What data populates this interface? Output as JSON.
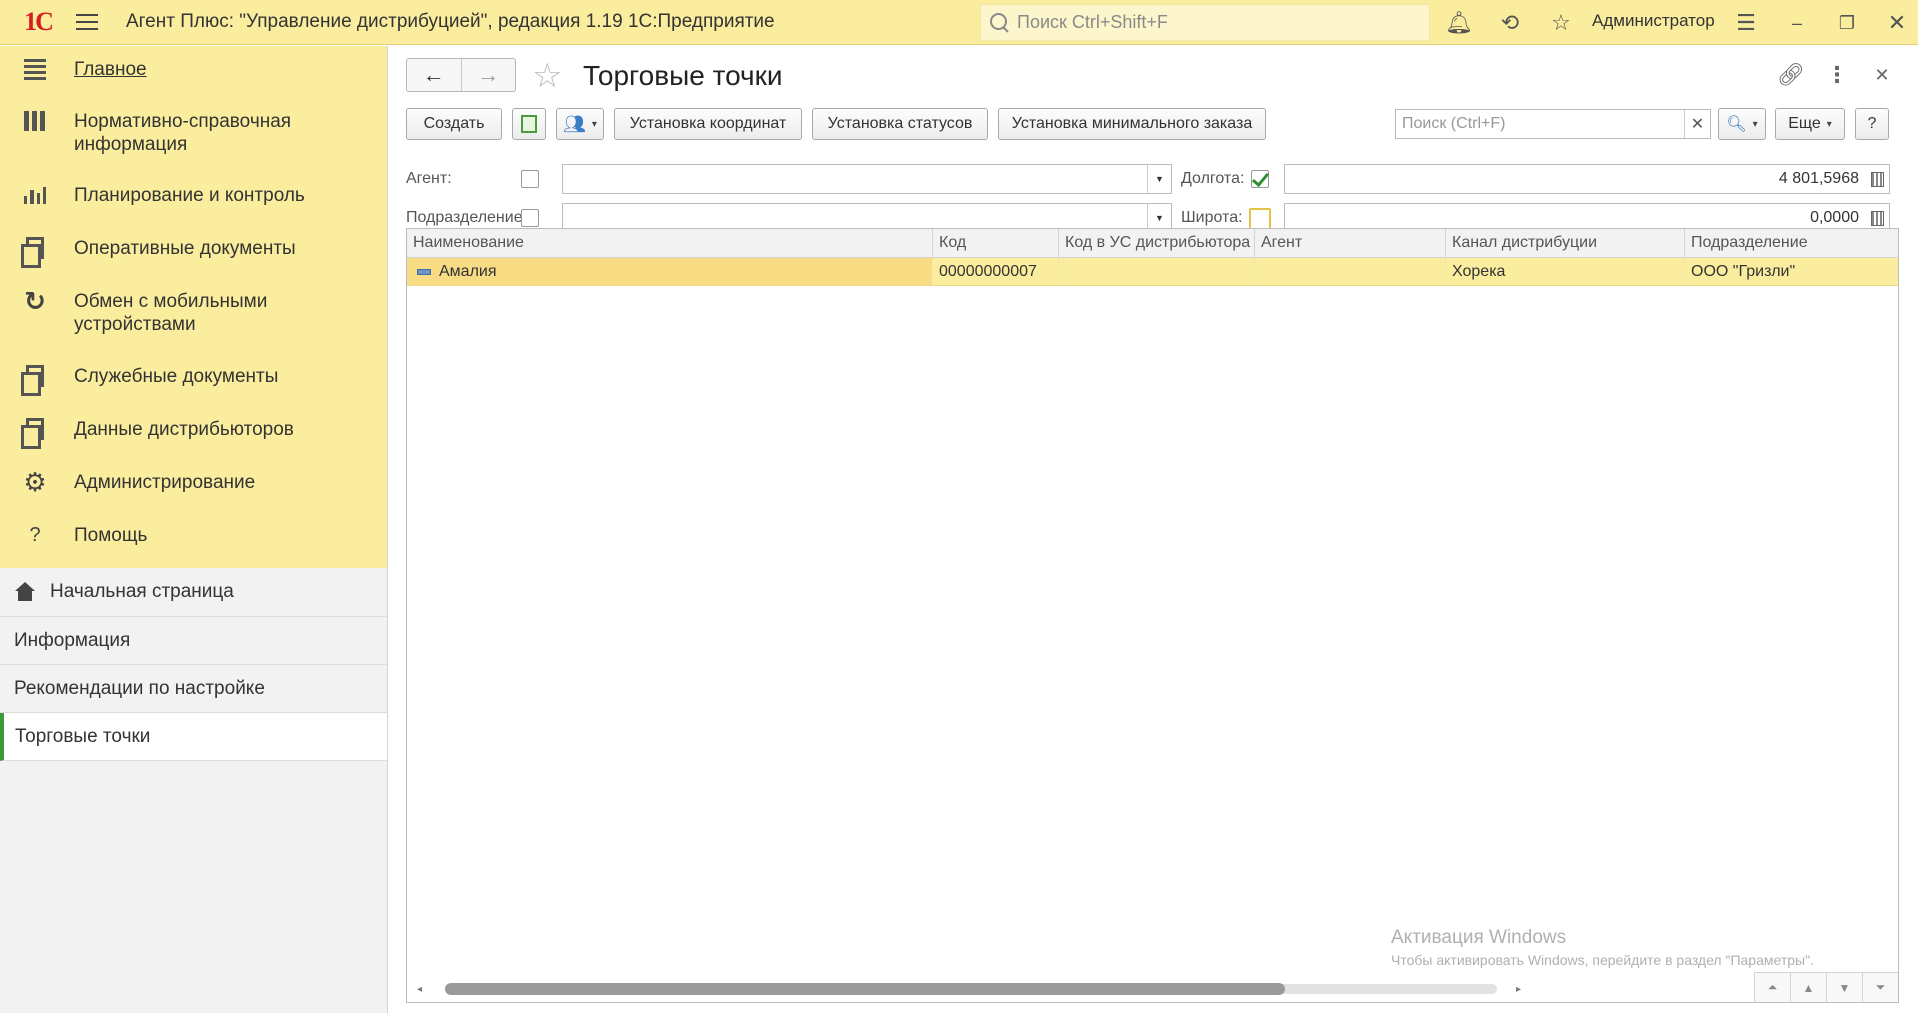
{
  "app": {
    "logo": "1С",
    "title": "Агент Плюс: \"Управление дистрибуцией\", редакция 1.19 1С:Предприятие",
    "search_placeholder": "Поиск Ctrl+Shift+F",
    "user": "Администратор"
  },
  "sidebar": {
    "menu": [
      {
        "label": "Главное",
        "icon": "menu-bars-icon"
      },
      {
        "label": "Нормативно-справочная информация",
        "icon": "catalog-icon"
      },
      {
        "label": "Планирование и контроль",
        "icon": "chart-icon"
      },
      {
        "label": "Оперативные документы",
        "icon": "documents-icon"
      },
      {
        "label": "Обмен с мобильными устройствами",
        "icon": "sync-icon"
      },
      {
        "label": "Служебные документы",
        "icon": "service-docs-icon"
      },
      {
        "label": "Данные дистрибьюторов",
        "icon": "distributor-data-icon"
      },
      {
        "label": "Администрирование",
        "icon": "gear-icon"
      },
      {
        "label": "Помощь",
        "icon": "help-icon"
      }
    ],
    "open_windows": [
      {
        "label": "Начальная страница"
      },
      {
        "label": "Информация"
      },
      {
        "label": "Рекомендации по настройке"
      },
      {
        "label": "Торговые точки"
      }
    ]
  },
  "page": {
    "title": "Торговые точки",
    "toolbar": {
      "create": "Создать",
      "set_coordinates": "Установка координат",
      "set_statuses": "Установка статусов",
      "set_min_order": "Установка минимального заказа",
      "search_placeholder": "Поиск (Ctrl+F)",
      "more": "Еще",
      "help": "?"
    },
    "filters": {
      "agent_label": "Агент:",
      "agent_value": "",
      "division_label": "Подразделение:",
      "division_value": "",
      "longitude_label": "Долгота:",
      "longitude_value": "4 801,5968",
      "latitude_label": "Широта:",
      "latitude_value": "0,0000"
    },
    "table": {
      "columns": [
        "Наименование",
        "Код",
        "Код в УС дистрибьютора",
        "Агент",
        "Канал дистрибуции",
        "Подразделение"
      ],
      "rows": [
        [
          "Амалия",
          "00000000007",
          "",
          "",
          "Хорека",
          "ООО \"Гризли\""
        ]
      ]
    },
    "watermark": {
      "line1": "Активация Windows",
      "line2": "Чтобы активировать Windows, перейдите в раздел \"Параметры\"."
    }
  },
  "colors": {
    "accent": "#fbed9e",
    "selected_row": "#fbed9e",
    "active_marker": "#3c9a3a",
    "logo": "#d6201f"
  }
}
